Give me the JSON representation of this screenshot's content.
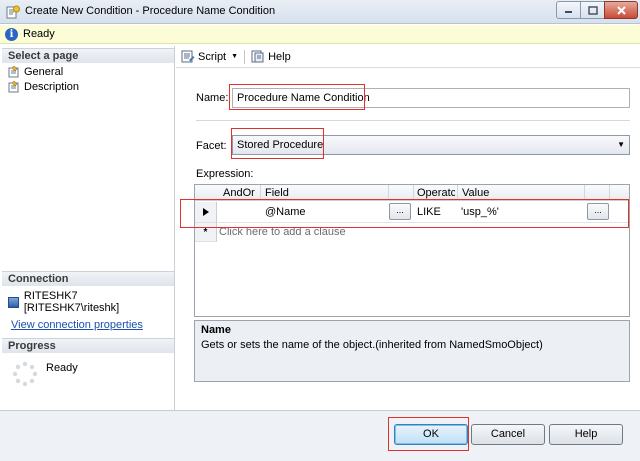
{
  "window": {
    "title": "Create New Condition - Procedure Name Condition"
  },
  "status": {
    "text": "Ready"
  },
  "left": {
    "select_page_header": "Select a page",
    "pages": [
      {
        "label": "General",
        "icon": "property-page-icon"
      },
      {
        "label": "Description",
        "icon": "property-page-icon"
      }
    ],
    "connection_header": "Connection",
    "connection_text": "RITESHK7 [RITESHK7\\riteshk]",
    "connection_link": "View connection properties",
    "progress_header": "Progress",
    "progress_text": "Ready"
  },
  "toolbar": {
    "script_label": "Script",
    "help_label": "Help"
  },
  "form": {
    "name_label": "Name:",
    "name_value": "Procedure Name Condition",
    "facet_label": "Facet:",
    "facet_value": "Stored Procedure",
    "expression_label": "Expression:"
  },
  "grid": {
    "columns": [
      "AndOr",
      "Field",
      "Operatc",
      "Value"
    ],
    "rows": [
      {
        "andor": "",
        "field": "@Name",
        "field_btn": "...",
        "operator": "LIKE",
        "value": "'usp_%'",
        "value_btn": "..."
      }
    ],
    "new_row_marker": "*",
    "add_clause_text": "Click here to add a clause"
  },
  "description": {
    "title": "Name",
    "text": "Gets or sets the name of the object.(inherited from NamedSmoObject)"
  },
  "buttons": {
    "ok": "OK",
    "cancel": "Cancel",
    "help": "Help"
  },
  "colors": {
    "highlight": "#e0312b",
    "link": "#1c4fae",
    "status_bg": "#fcfcd6"
  }
}
